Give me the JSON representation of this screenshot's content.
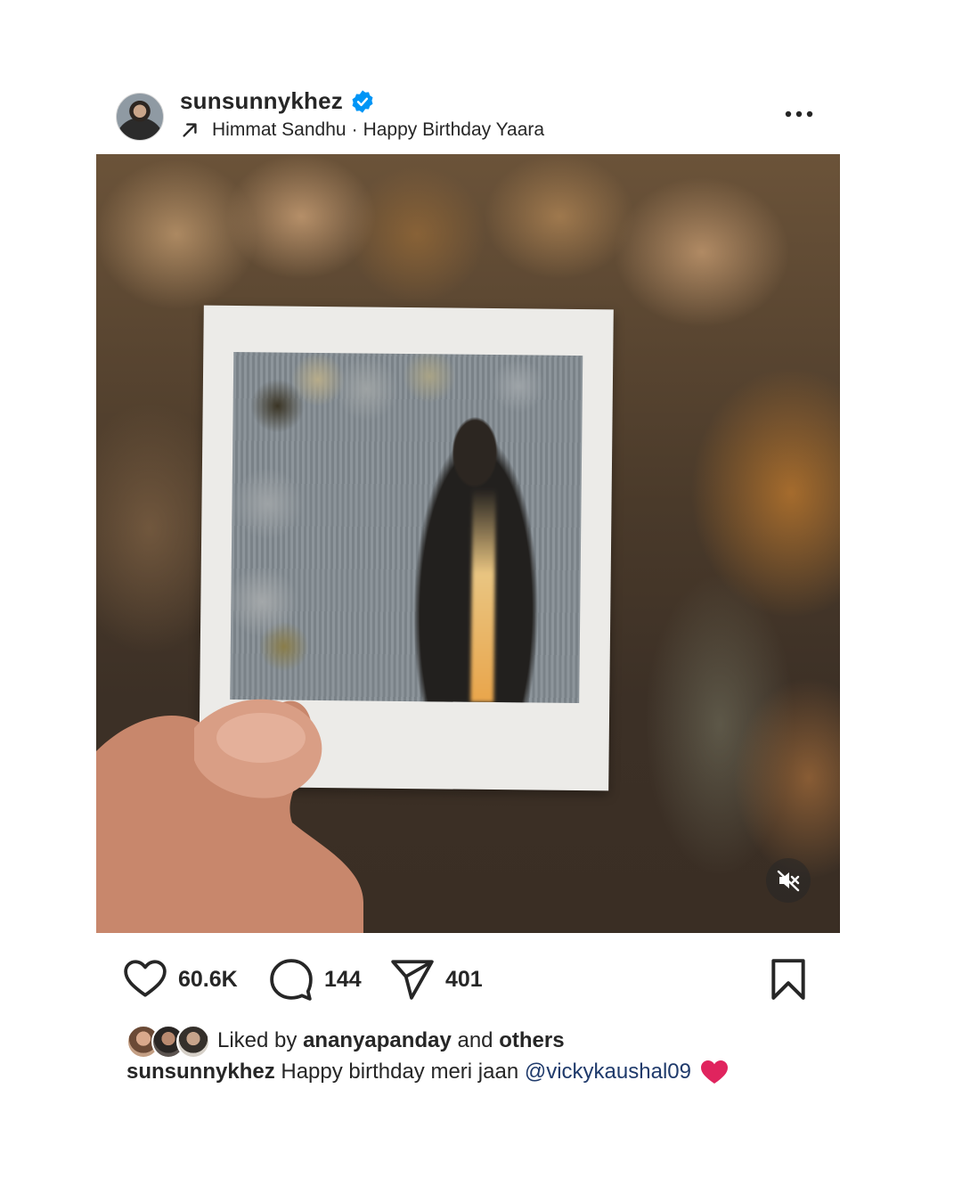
{
  "header": {
    "username": "sunsunnykhez",
    "verified": true,
    "audio": {
      "artist": "Himmat Sandhu",
      "separator": "·",
      "track": "Happy Birthday Yaara"
    },
    "icons": {
      "audio": "arrow-up-right-icon",
      "more": "more-options-icon",
      "verified": "verified-badge-icon"
    }
  },
  "media": {
    "type": "video",
    "muted": true,
    "icons": {
      "mute": "muted-speaker-icon"
    }
  },
  "actions": {
    "likes": "60.6K",
    "comments": "144",
    "shares": "401",
    "icons": {
      "like": "heart-icon",
      "comment": "comment-icon",
      "share": "send-icon",
      "save": "bookmark-icon"
    }
  },
  "likes_row": {
    "prefix": "Liked by",
    "liker": "ananyapanday",
    "conjunction": "and",
    "others": "others"
  },
  "caption": {
    "author": "sunsunnykhez",
    "text": "Happy birthday meri jaan",
    "mention": "@vickykaushal09",
    "emoji": "red-heart-icon"
  },
  "colors": {
    "text": "#262626",
    "verified": "#0095f6",
    "mention": "#1f3a6b",
    "heart": "#e0245e"
  }
}
